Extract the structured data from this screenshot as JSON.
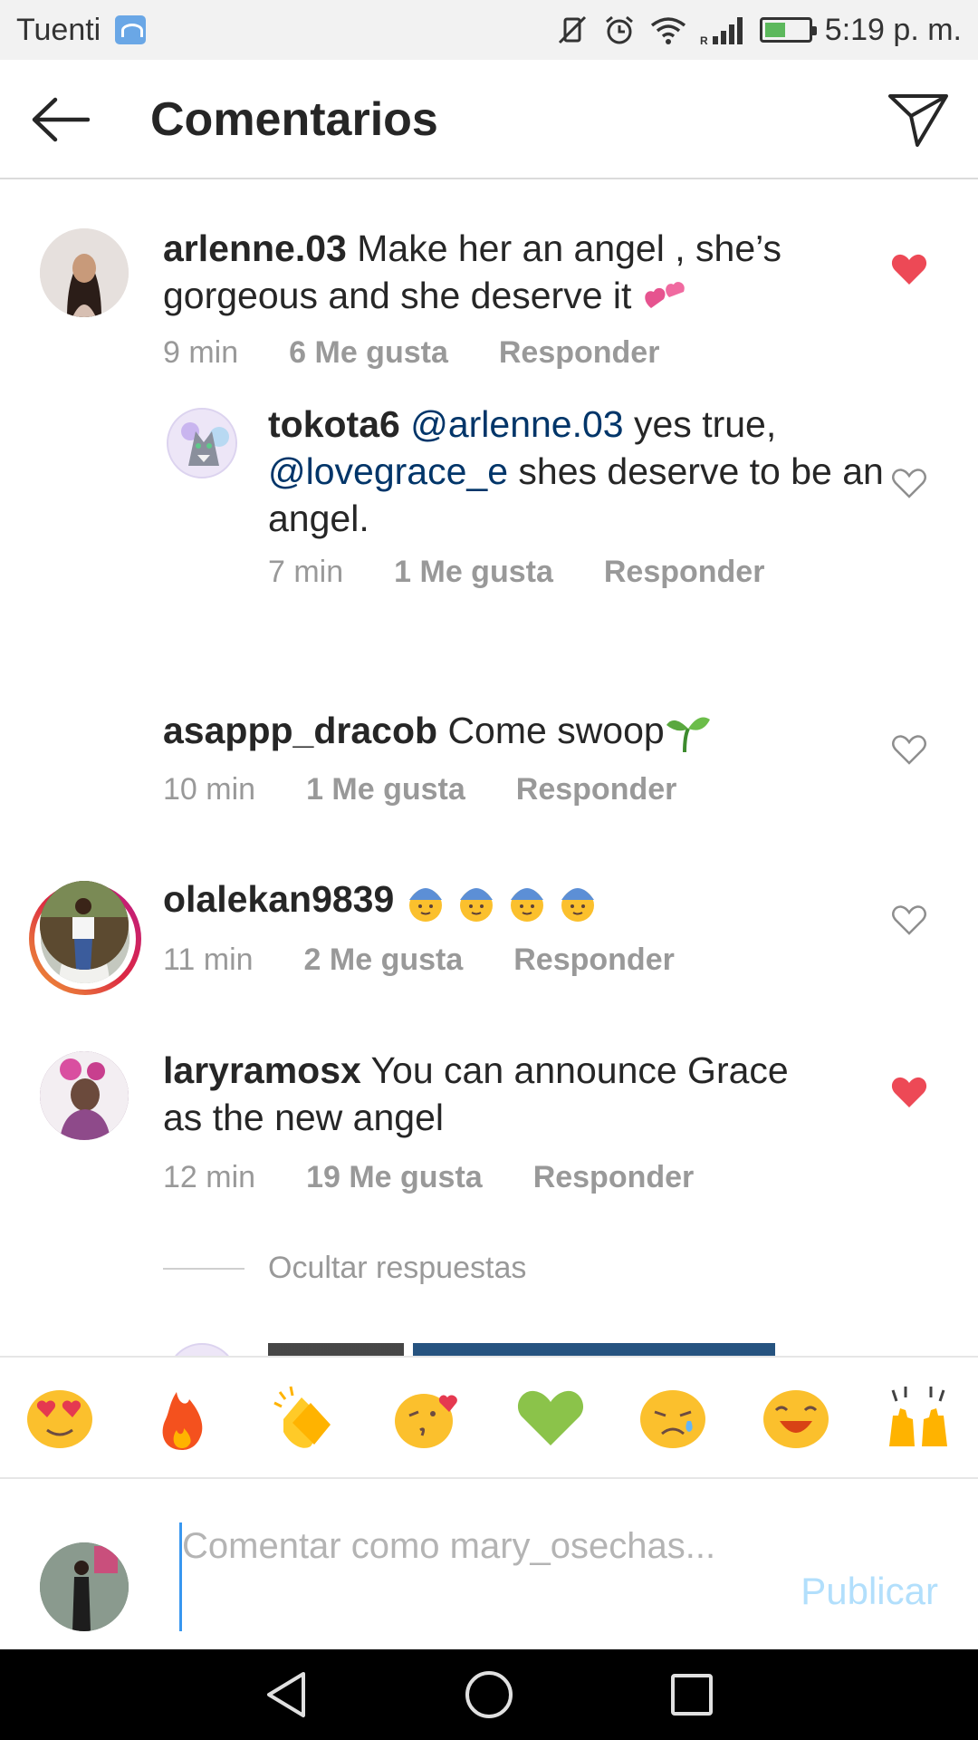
{
  "status_bar": {
    "carrier": "Tuenti",
    "time": "5:19 p. m.",
    "signal_label": "R"
  },
  "header": {
    "title": "Comentarios",
    "back_icon": "arrow-left-icon",
    "share_icon": "paper-plane-icon"
  },
  "comments": [
    {
      "username": "arlenne.03",
      "text": " Make her an angel , she’s gorgeous and she deserve it ",
      "emoji": "two-hearts",
      "time": "9 min",
      "likes": "6 Me gusta",
      "reply": "Responder",
      "liked": true
    },
    {
      "username": "tokota6",
      "mention1": "@arlenne.03",
      "text1": " yes true, ",
      "mention2": "@lovegrace_e",
      "text2": " shes deserve to be an angel.",
      "time": "7 min",
      "likes": "1 Me gusta",
      "reply": "Responder",
      "liked": false
    },
    {
      "username": "asappp_dracob",
      "text": " Come swoop",
      "emoji": "seedling",
      "time": "10 min",
      "likes": "1 Me gusta",
      "reply": "Responder",
      "liked": false
    },
    {
      "username": "olalekan9839",
      "text": " ",
      "emoji": "boy-with-cap x4",
      "time": "11 min",
      "likes": "2 Me gusta",
      "reply": "Responder",
      "liked": false
    },
    {
      "username": "laryramosx",
      "text": " You can announce Grace as the new angel",
      "time": "12 min",
      "likes": "19 Me gusta",
      "reply": "Responder",
      "liked": true
    }
  ],
  "hide_replies": "Ocultar respuestas",
  "emoji_bar": [
    "heart-eyes",
    "fire",
    "clapping-hands",
    "kissing-heart",
    "green-heart",
    "sad-face",
    "laughing-face",
    "raised-hands"
  ],
  "composer": {
    "placeholder": "Comentar como mary_osechas...",
    "publish": "Publicar"
  },
  "colors": {
    "liked_heart": "#ed4956",
    "mention": "#003569",
    "publish_disabled": "#b2dffc",
    "meta_gray": "#999999"
  }
}
